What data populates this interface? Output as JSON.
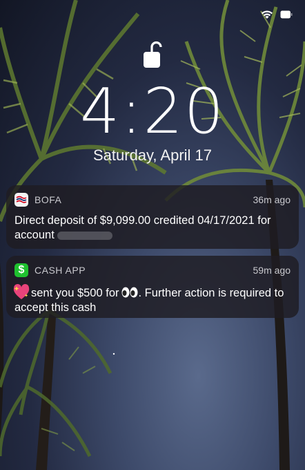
{
  "lock_screen": {
    "time": "4:20",
    "date": "Saturday, April 17"
  },
  "status_bar": {
    "icons": [
      "wifi-icon",
      "battery-icon"
    ]
  },
  "notifications": [
    {
      "app_name": "BOFA",
      "time": "36m ago",
      "icon": "bofa-flag-icon",
      "body": "Direct deposit of $9,099.00 credited 04/17/2021 for account"
    },
    {
      "app_name": "CASH APP",
      "time": "59m ago",
      "icon": "cash-app-dollar-icon",
      "icon_glyph": "$",
      "body_part1": "sent you $500 for",
      "body_part2": ". Further action is required to accept this cash"
    }
  ],
  "colors": {
    "cash_green": "#1fc12f",
    "bofa_red": "#d4001a",
    "bofa_blue": "#012169"
  }
}
